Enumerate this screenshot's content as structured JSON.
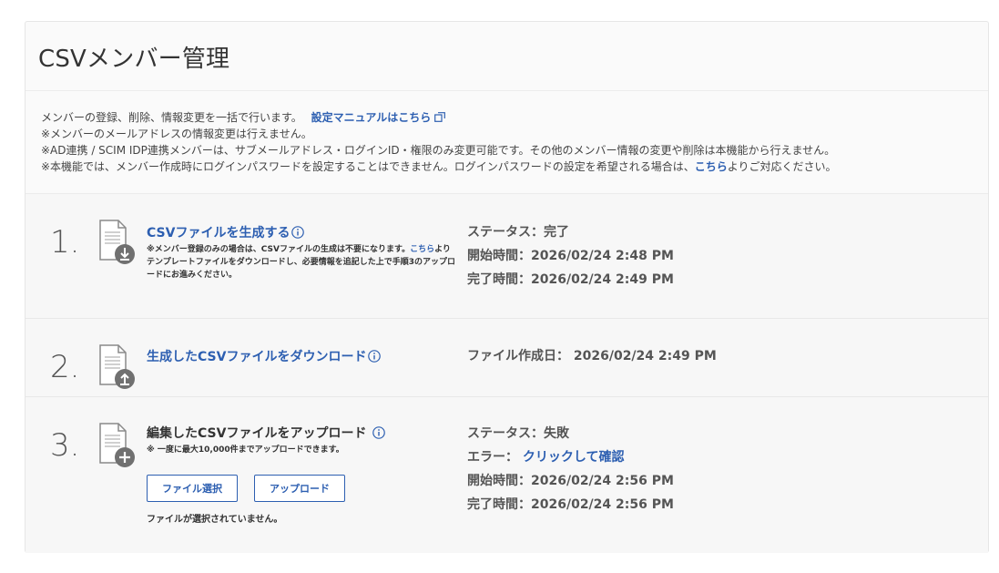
{
  "page": {
    "title": "CSVメンバー管理"
  },
  "intro": {
    "line1_text": "メンバーの登録、削除、情報変更を一括で行います。",
    "line1_link": "設定マニュアルはこちら",
    "line2": "※メンバーのメールアドレスの情報変更は行えません。",
    "line3": "※AD連携 / SCIM IDP連携メンバーは、サブメールアドレス・ログインID・権限のみ変更可能です。その他のメンバー情報の変更や削除は本機能から行えません。",
    "line4_before": "※本機能では、メンバー作成時にログインパスワードを設定することはできません。ログインパスワードの設定を希望される場合は、",
    "line4_link": "こちら",
    "line4_after": "よりご対応ください。"
  },
  "steps": [
    {
      "number": "1.",
      "icon": "file-download-icon",
      "title": "CSVファイルを生成する",
      "note_before": "※メンバー登録のみの場合は、CSVファイルの生成は不要になります。",
      "note_link": "こちら",
      "note_after": "よりテンプレートファイルをダウンロードし、必要情報を追記した上で手順3のアップロードにお進みください。",
      "status_lines": [
        "ステータス：完了",
        "開始時間：2026/02/24 2:48 PM",
        "完了時間：2026/02/24 2:49 PM"
      ]
    },
    {
      "number": "2.",
      "icon": "file-upload-icon",
      "title": "生成したCSVファイルをダウンロード",
      "status_lines": [
        "ファイル作成日： 2026/02/24 2:49 PM"
      ]
    },
    {
      "number": "3.",
      "icon": "file-add-icon",
      "title": "編集したCSVファイルをアップロード",
      "note": "※ 一度に最大10,000件までアップロードできます。",
      "file_select_label": "ファイル選択",
      "upload_label": "アップロード",
      "file_status": "ファイルが選択されていません。",
      "status_line1": "ステータス：失敗",
      "error_label": "エラー：",
      "error_link": "クリックして確認",
      "status_line3": "開始時間：2026/02/24 2:56 PM",
      "status_line4": "完了時間：2026/02/24 2:56 PM"
    }
  ],
  "colors": {
    "link": "#2d5fb1",
    "text": "#333333",
    "background": "#f7f7f7"
  }
}
